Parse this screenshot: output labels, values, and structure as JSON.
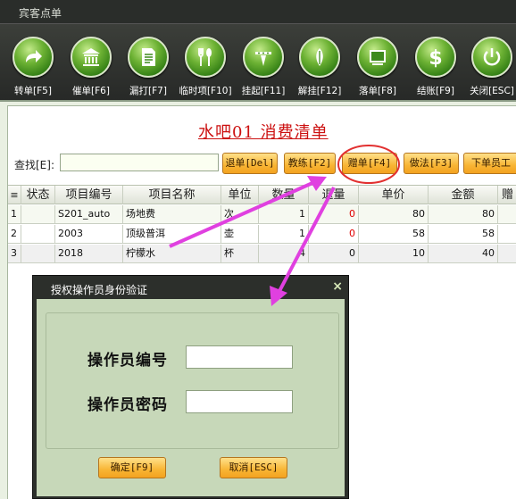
{
  "window": {
    "title": "宾客点单"
  },
  "toolbar": {
    "buttons": [
      {
        "label": "转单[F5]",
        "icon": "arrow-right-icon"
      },
      {
        "label": "催单[F6]",
        "icon": "bank-icon"
      },
      {
        "label": "漏打[F7]",
        "icon": "document-icon"
      },
      {
        "label": "临时项[F10]",
        "icon": "fork-spoon-icon"
      },
      {
        "label": "挂起[F11]",
        "icon": "pin-icon"
      },
      {
        "label": "解挂[F12]",
        "icon": "leaf-icon"
      },
      {
        "label": "落单[F8]",
        "icon": "monitor-icon"
      },
      {
        "label": "结账[F9]",
        "icon": "dollar-icon"
      },
      {
        "label": "关闭[ESC]",
        "icon": "power-icon"
      }
    ]
  },
  "bill": {
    "title": "水吧01 消费清单"
  },
  "search": {
    "label": "查找[E]:",
    "value": ""
  },
  "actions": {
    "refund": "退单[Del]",
    "urge": "教练[F2]",
    "gift": "赠单[F4]",
    "method": "做法[F3]",
    "staff": "下单员工"
  },
  "table": {
    "headers": [
      "≡",
      "状态",
      "项目编号",
      "项目名称",
      "单位",
      "数量",
      "退量",
      "单价",
      "金额",
      "赠"
    ],
    "rows": [
      {
        "idx": "1",
        "status": "",
        "code": "S201_auto",
        "name": "场地费",
        "unit": "次",
        "qty": "1",
        "refund": "0",
        "price": "80",
        "amount": "80"
      },
      {
        "idx": "2",
        "status": "",
        "code": "2003",
        "name": "顶级普洱",
        "unit": "壶",
        "qty": "1",
        "refund": "0",
        "price": "58",
        "amount": "58"
      },
      {
        "idx": "3",
        "status": "",
        "code": "2018",
        "name": "柠檬水",
        "unit": "杯",
        "qty": "4",
        "refund": "0",
        "price": "10",
        "amount": "40"
      }
    ]
  },
  "dialog": {
    "title": "授权操作员身份验证",
    "close": "×",
    "operator_id_label": "操作员编号",
    "operator_pwd_label": "操作员密码",
    "confirm": "确定[F9]",
    "cancel": "取消[ESC]"
  },
  "colors": {
    "accent_orange": "#f8b534",
    "annotation": "#e040e0",
    "title_red": "#cc1010"
  }
}
